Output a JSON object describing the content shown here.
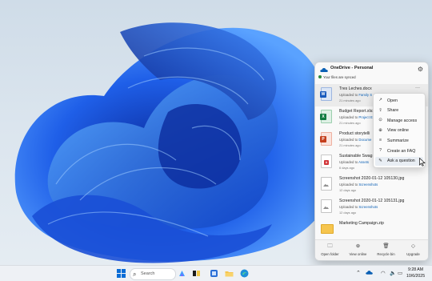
{
  "flyout": {
    "title": "OneDrive - Personal",
    "status": "Your files are synced",
    "settings_icon": "gear-icon",
    "files": [
      {
        "name": "Tres Leches.docx",
        "uploaded": "Uploaded to",
        "location": "Family S",
        "time": "21 minutes ago",
        "type": "word",
        "badge": "W"
      },
      {
        "name": "Budget Report.xlsx",
        "uploaded": "Uploaded to",
        "location": "Project E",
        "time": "21 minutes ago",
        "type": "excel",
        "badge": "X"
      },
      {
        "name": "Product storytelli",
        "uploaded": "Uploaded to",
        "location": "Docume",
        "time": "21 minutes ago",
        "type": "ppt",
        "badge": "P"
      },
      {
        "name": "Sustainable Swag",
        "uploaded": "Uploaded to",
        "location": "Assets",
        "time": "6 days ago",
        "type": "pdf",
        "badge": "A"
      },
      {
        "name": "Screenshot 2020-01-12 105130.jpg",
        "uploaded": "Uploaded to",
        "location": "Screenshots",
        "time": "12 days ago",
        "type": "img",
        "badge": ""
      },
      {
        "name": "Screenshot 2020-01-12 105131.jpg",
        "uploaded": "Uploaded to",
        "location": "Screenshots",
        "time": "12 days ago",
        "type": "img",
        "badge": ""
      },
      {
        "name": "Marketing Campaign.zip",
        "uploaded": "",
        "location": "",
        "time": "",
        "type": "folder",
        "badge": ""
      }
    ],
    "footer": [
      {
        "label": "Open folder",
        "icon": "folder-icon",
        "glyph": "🗀"
      },
      {
        "label": "View online",
        "icon": "globe-icon",
        "glyph": "⊕"
      },
      {
        "label": "Recycle bin",
        "icon": "trash-icon",
        "glyph": "🗑"
      },
      {
        "label": "Upgrade",
        "icon": "diamond-icon",
        "glyph": "◇"
      }
    ]
  },
  "context_menu": {
    "items": [
      {
        "label": "Open",
        "icon": "open-icon",
        "glyph": "↗"
      },
      {
        "label": "Share",
        "icon": "share-icon",
        "glyph": "⇪"
      },
      {
        "label": "Manage access",
        "icon": "manage-access-icon",
        "glyph": "⊙"
      },
      {
        "label": "View online",
        "icon": "globe-icon",
        "glyph": "⊕"
      },
      {
        "label": "Summarize",
        "icon": "summarize-icon",
        "glyph": "≡"
      },
      {
        "label": "Create an FAQ",
        "icon": "faq-icon",
        "glyph": "?"
      },
      {
        "label": "Ask a question",
        "icon": "chat-icon",
        "glyph": "✎"
      }
    ]
  },
  "taskbar": {
    "search_label": "Search",
    "clock_time": "9:28 AM",
    "clock_date": "10/6/2025"
  },
  "colors": {
    "accent": "#0a5fb4",
    "bloom_dark": "#0a2fa8",
    "bloom_light": "#3f8cff"
  }
}
